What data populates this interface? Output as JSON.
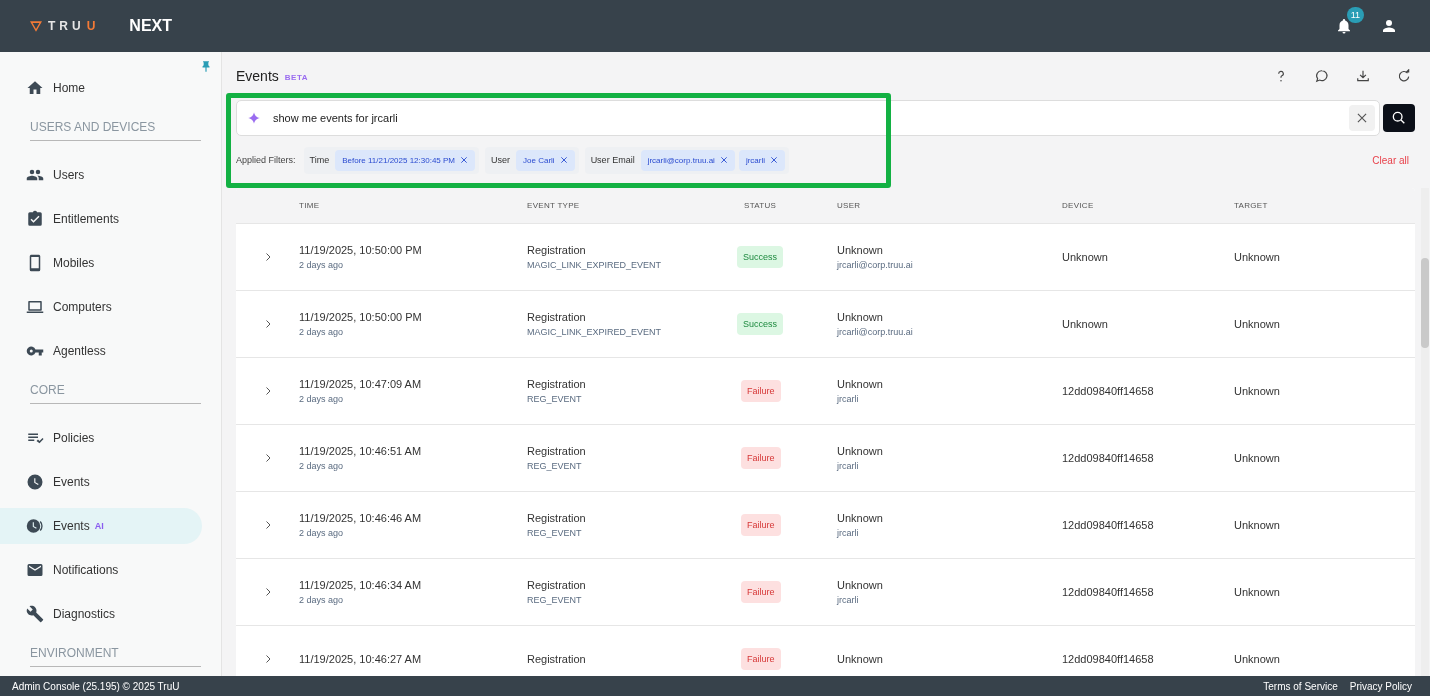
{
  "header": {
    "logo": "TRUU",
    "product": "NEXT",
    "notifications": "11"
  },
  "sidebar": {
    "groups": [
      {
        "items": [
          {
            "label": "Home",
            "selected": false
          }
        ]
      },
      {
        "title": "USERS AND DEVICES",
        "items": [
          {
            "label": "Users",
            "selected": false
          },
          {
            "label": "Entitlements",
            "selected": false
          },
          {
            "label": "Mobiles",
            "selected": false
          },
          {
            "label": "Computers",
            "selected": false
          },
          {
            "label": "Agentless",
            "selected": false
          }
        ]
      },
      {
        "title": "CORE",
        "items": [
          {
            "label": "Policies",
            "selected": false
          },
          {
            "label": "Events",
            "selected": false
          },
          {
            "label": "Events",
            "badge": "AI",
            "selected": true
          },
          {
            "label": "Notifications",
            "selected": false
          },
          {
            "label": "Diagnostics",
            "selected": false
          }
        ]
      },
      {
        "title": "ENVIRONMENT"
      }
    ]
  },
  "page": {
    "title": "Events",
    "badge": "BETA"
  },
  "search": {
    "value": "show me events for jrcarli"
  },
  "filters": {
    "label": "Applied Filters:",
    "clear": "Clear all",
    "groups": [
      {
        "label": "Time",
        "chips": [
          "Before 11/21/2025 12:30:45 PM"
        ]
      },
      {
        "label": "User",
        "chips": [
          "Joe Carli"
        ]
      },
      {
        "label": "User Email",
        "chips": [
          "jrcarli@corp.truu.ai",
          "jrcarli"
        ]
      }
    ]
  },
  "table": {
    "columns": [
      "TIME",
      "EVENT TYPE",
      "STATUS",
      "USER",
      "DEVICE",
      "TARGET"
    ],
    "rows": [
      {
        "time": "11/19/2025, 10:50:00 PM",
        "ago": "2 days ago",
        "type": "Registration",
        "code": "MAGIC_LINK_EXPIRED_EVENT",
        "status": {
          "label": "Success",
          "kind": "success"
        },
        "user": "Unknown",
        "user_sub": "jrcarli@corp.truu.ai",
        "device": "Unknown",
        "target": "Unknown"
      },
      {
        "time": "11/19/2025, 10:50:00 PM",
        "ago": "2 days ago",
        "type": "Registration",
        "code": "MAGIC_LINK_EXPIRED_EVENT",
        "status": {
          "label": "Success",
          "kind": "success"
        },
        "user": "Unknown",
        "user_sub": "jrcarli@corp.truu.ai",
        "device": "Unknown",
        "target": "Unknown"
      },
      {
        "time": "11/19/2025, 10:47:09 AM",
        "ago": "2 days ago",
        "type": "Registration",
        "code": "REG_EVENT",
        "status": {
          "label": "Failure",
          "kind": "failure"
        },
        "user": "Unknown",
        "user_sub": "jrcarli",
        "device": "12dd09840ff14658",
        "target": "Unknown"
      },
      {
        "time": "11/19/2025, 10:46:51 AM",
        "ago": "2 days ago",
        "type": "Registration",
        "code": "REG_EVENT",
        "status": {
          "label": "Failure",
          "kind": "failure"
        },
        "user": "Unknown",
        "user_sub": "jrcarli",
        "device": "12dd09840ff14658",
        "target": "Unknown"
      },
      {
        "time": "11/19/2025, 10:46:46 AM",
        "ago": "2 days ago",
        "type": "Registration",
        "code": "REG_EVENT",
        "status": {
          "label": "Failure",
          "kind": "failure"
        },
        "user": "Unknown",
        "user_sub": "jrcarli",
        "device": "12dd09840ff14658",
        "target": "Unknown"
      },
      {
        "time": "11/19/2025, 10:46:34 AM",
        "ago": "2 days ago",
        "type": "Registration",
        "code": "REG_EVENT",
        "status": {
          "label": "Failure",
          "kind": "failure"
        },
        "user": "Unknown",
        "user_sub": "jrcarli",
        "device": "12dd09840ff14658",
        "target": "Unknown"
      },
      {
        "time": "11/19/2025, 10:46:27 AM",
        "type": "Registration",
        "status": {
          "label": "Failure",
          "kind": "failure"
        },
        "user": "Unknown",
        "device": "12dd09840ff14658",
        "target": "Unknown"
      }
    ]
  },
  "footer": {
    "copyright": "Admin Console (25.195) © 2025 TruU",
    "links": [
      "Terms of Service",
      "Privacy Policy"
    ]
  }
}
